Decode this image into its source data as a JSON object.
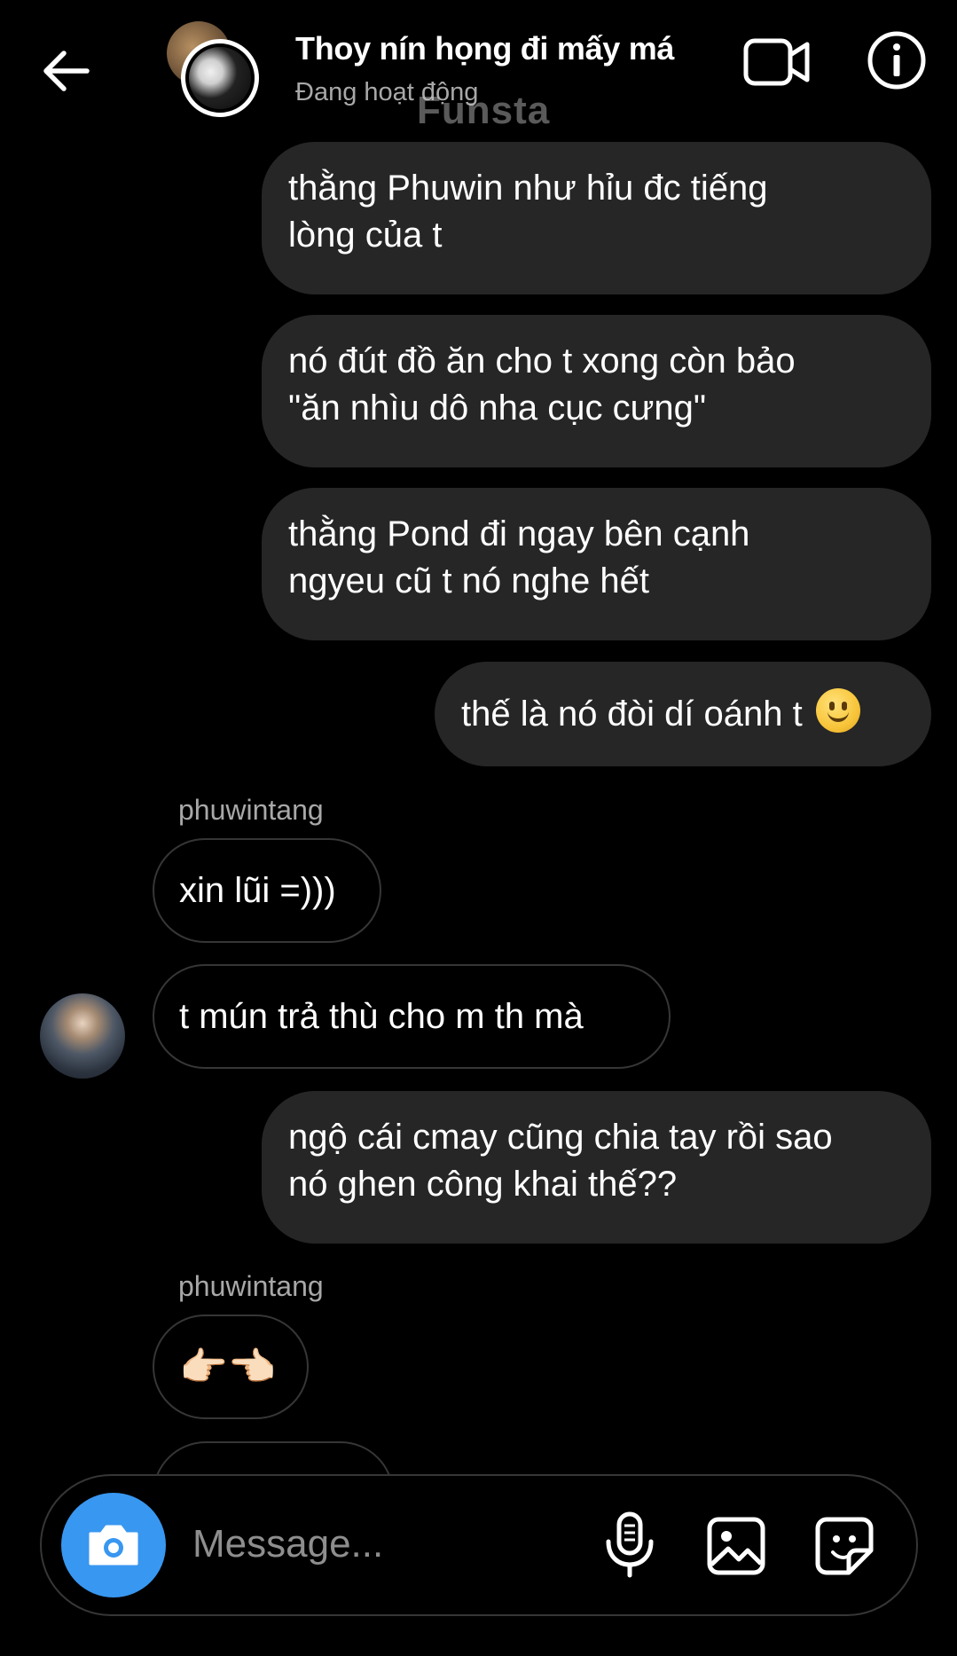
{
  "header": {
    "title": "Thoy nín họng đi mấy má",
    "status": "Đang hoạt động",
    "watermark": "Funsta"
  },
  "messages": [
    {
      "direction": "out",
      "text_lines": [
        "thằng Phuwin như hỉu đc tiếng",
        "lòng của t"
      ]
    },
    {
      "direction": "out",
      "text_lines": [
        "nó đút đồ ăn cho t xong còn bảo",
        "\"ăn nhìu dô nha cục cưng\""
      ]
    },
    {
      "direction": "out",
      "text_lines": [
        "thằng Pond đi ngay bên cạnh",
        "ngyeu cũ t nó nghe hết"
      ]
    },
    {
      "direction": "out",
      "text": "thế là nó đòi dí oánh t",
      "emoji": "slightly-smiling-face"
    },
    {
      "direction": "in",
      "sender": "phuwintang",
      "text": "xin lũi =)))"
    },
    {
      "direction": "in",
      "text": "t mún trả thù cho m th mà"
    },
    {
      "direction": "out",
      "text_lines": [
        "ngộ cái cmay cũng chia tay rồi sao",
        "nó ghen công khai thế??"
      ]
    },
    {
      "direction": "in",
      "sender": "phuwintang",
      "text": "👉🏻👈🏻"
    }
  ],
  "composer": {
    "placeholder": "Message...",
    "icons": [
      "camera-icon",
      "microphone-icon",
      "gallery-icon",
      "sticker-icon"
    ]
  },
  "colors": {
    "background": "#000000",
    "outgoing_bubble": "#262626",
    "incoming_border": "#363636",
    "camera_button": "#3897f0",
    "secondary_text": "#a8a8a8"
  }
}
